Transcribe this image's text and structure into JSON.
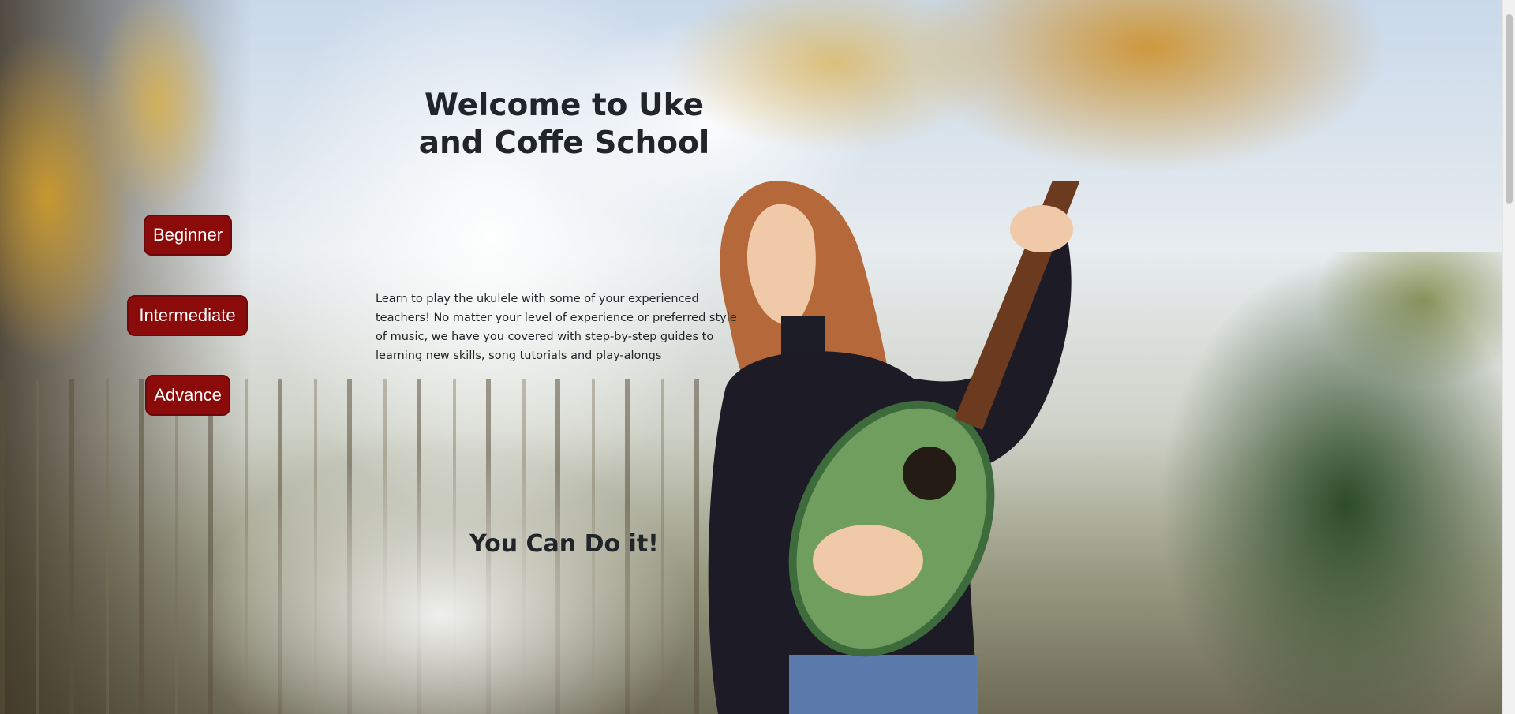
{
  "hero": {
    "title": "Welcome to Uke and Coffe School",
    "description": "Learn to play the ukulele with some of your experienced teachers! No matter your level of experience or preferred style of music, we have you covered with step-by-step guides to learning new skills, song tutorials and play-alongs",
    "subtitle": "You Can Do it!"
  },
  "levels": {
    "beginner": "Beginner",
    "intermediate": "Intermediate",
    "advance": "Advance"
  },
  "colors": {
    "button_bg": "#8b0a0a",
    "text": "#212529"
  }
}
